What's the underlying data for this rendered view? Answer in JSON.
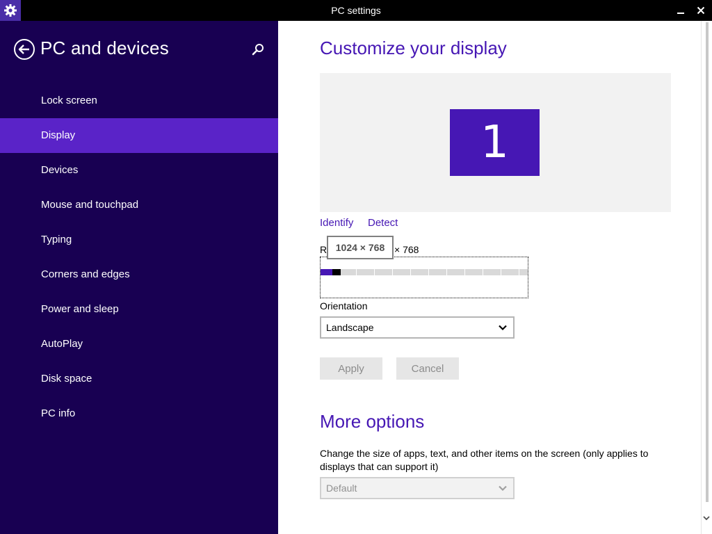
{
  "window": {
    "title": "PC settings",
    "app_icon": "gear-icon",
    "minimize_label": "–",
    "close_label": "✕"
  },
  "sidebar": {
    "title": "PC and devices",
    "back_icon": "back-arrow-icon",
    "search_icon": "search-icon",
    "items": [
      {
        "label": "Lock screen",
        "selected": false
      },
      {
        "label": "Display",
        "selected": true
      },
      {
        "label": "Devices",
        "selected": false
      },
      {
        "label": "Mouse and touchpad",
        "selected": false
      },
      {
        "label": "Typing",
        "selected": false
      },
      {
        "label": "Corners and edges",
        "selected": false
      },
      {
        "label": "Power and sleep",
        "selected": false
      },
      {
        "label": "AutoPlay",
        "selected": false
      },
      {
        "label": "Disk space",
        "selected": false
      },
      {
        "label": "PC info",
        "selected": false
      }
    ]
  },
  "main": {
    "heading": "Customize your display",
    "monitor_number": "1",
    "identify_link": "Identify",
    "detect_link": "Detect",
    "resolution": {
      "label_start": "R",
      "value_tail": "× 768",
      "tooltip": "1024 × 768",
      "slider_position_fraction": 0.06
    },
    "orientation": {
      "label": "Orientation",
      "selected": "Landscape"
    },
    "apply_label": "Apply",
    "cancel_label": "Cancel",
    "more_options": {
      "heading": "More options",
      "description": "Change the size of apps, text, and other items on the screen (only applies to displays that can support it)",
      "size_selected": "Default"
    }
  },
  "colors": {
    "sidebar_bg": "#180052",
    "selected_item": "#5a23c8",
    "accent": "#4617b4"
  }
}
